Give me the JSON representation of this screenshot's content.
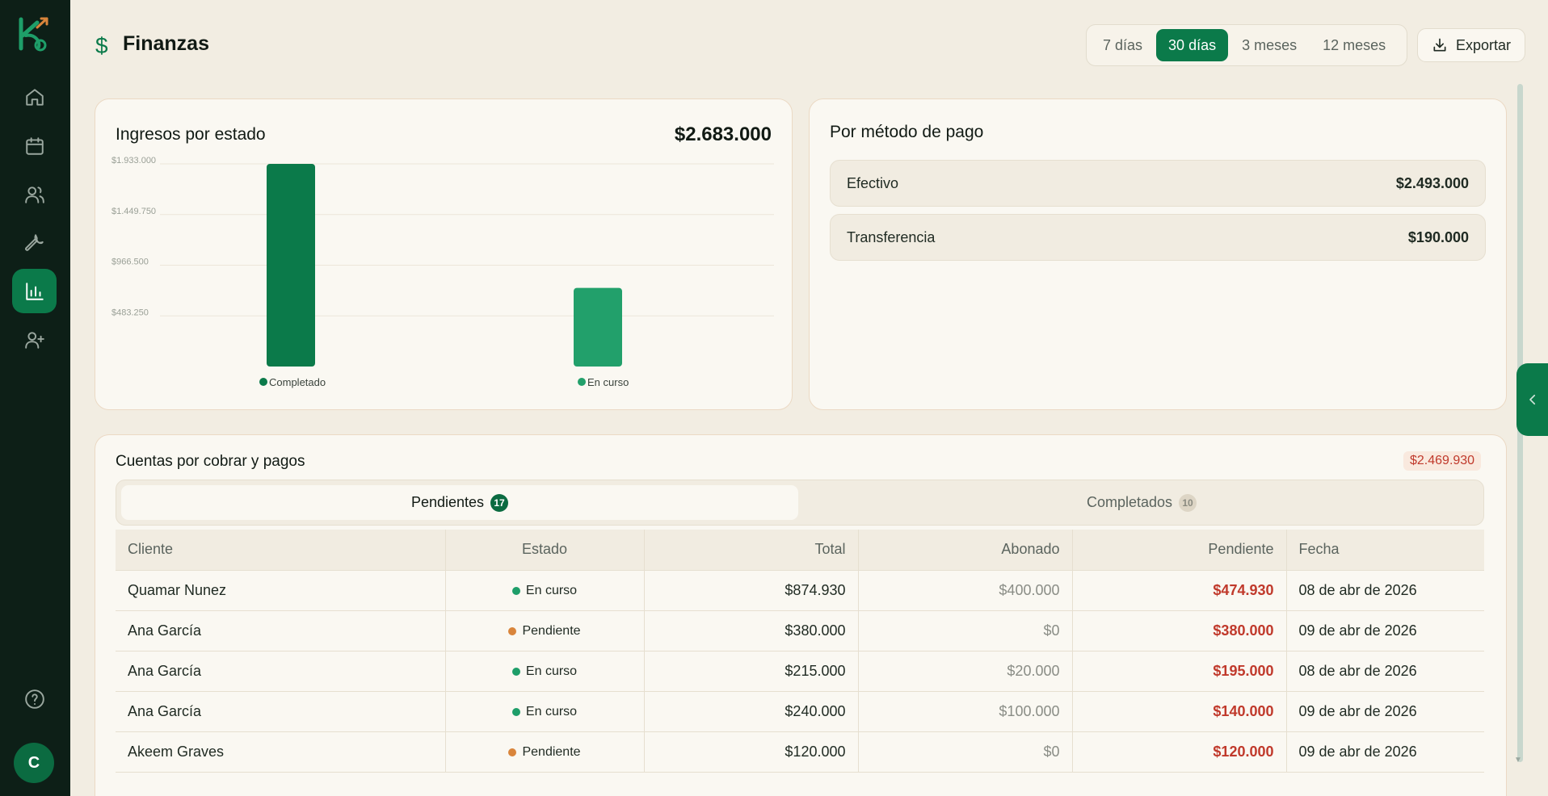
{
  "header": {
    "title": "Finanzas",
    "ranges": [
      "7 días",
      "30 días",
      "3 meses",
      "12 meses"
    ],
    "active_range": "30 días",
    "export_label": "Exportar"
  },
  "income_card": {
    "title": "Ingresos por estado",
    "total": "$2.683.000"
  },
  "chart_data": {
    "type": "bar",
    "categories": [
      "Completado",
      "En curso"
    ],
    "values": [
      1933000,
      750000
    ],
    "colors": [
      "#0b7a4a",
      "#22a06b"
    ],
    "ylim": [
      0,
      1933000
    ],
    "yticks": [
      483250,
      966500,
      1449750,
      1933000
    ],
    "ytick_labels": [
      "$483.250",
      "$966.500",
      "$1.449.750",
      "$1.933.000"
    ],
    "grid": true,
    "legend": "bottom"
  },
  "method_card": {
    "title": "Por método de pago",
    "rows": [
      {
        "label": "Efectivo",
        "amount": "$2.493.000"
      },
      {
        "label": "Transferencia",
        "amount": "$190.000"
      }
    ]
  },
  "accounts": {
    "title": "Cuentas por cobrar y pagos",
    "total_pending": "$2.469.930",
    "tabs": [
      {
        "label": "Pendientes",
        "count": "17"
      },
      {
        "label": "Completados",
        "count": "10"
      }
    ],
    "columns": [
      "Cliente",
      "Estado",
      "Total",
      "Abonado",
      "Pendiente",
      "Fecha"
    ],
    "rows": [
      {
        "cliente": "Quamar Nunez",
        "estado": "En curso",
        "total": "$874.930",
        "abonado": "$400.000",
        "pendiente": "$474.930",
        "fecha": "08 de abr de 2026"
      },
      {
        "cliente": "Ana García",
        "estado": "Pendiente",
        "total": "$380.000",
        "abonado": "$0",
        "pendiente": "$380.000",
        "fecha": "09 de abr de 2026"
      },
      {
        "cliente": "Ana García",
        "estado": "En curso",
        "total": "$215.000",
        "abonado": "$20.000",
        "pendiente": "$195.000",
        "fecha": "08 de abr de 2026"
      },
      {
        "cliente": "Ana García",
        "estado": "En curso",
        "total": "$240.000",
        "abonado": "$100.000",
        "pendiente": "$140.000",
        "fecha": "09 de abr de 2026"
      },
      {
        "cliente": "Akeem Graves",
        "estado": "Pendiente",
        "total": "$120.000",
        "abonado": "$0",
        "pendiente": "$120.000",
        "fecha": "09 de abr de 2026"
      }
    ]
  },
  "user": {
    "initial": "C"
  }
}
